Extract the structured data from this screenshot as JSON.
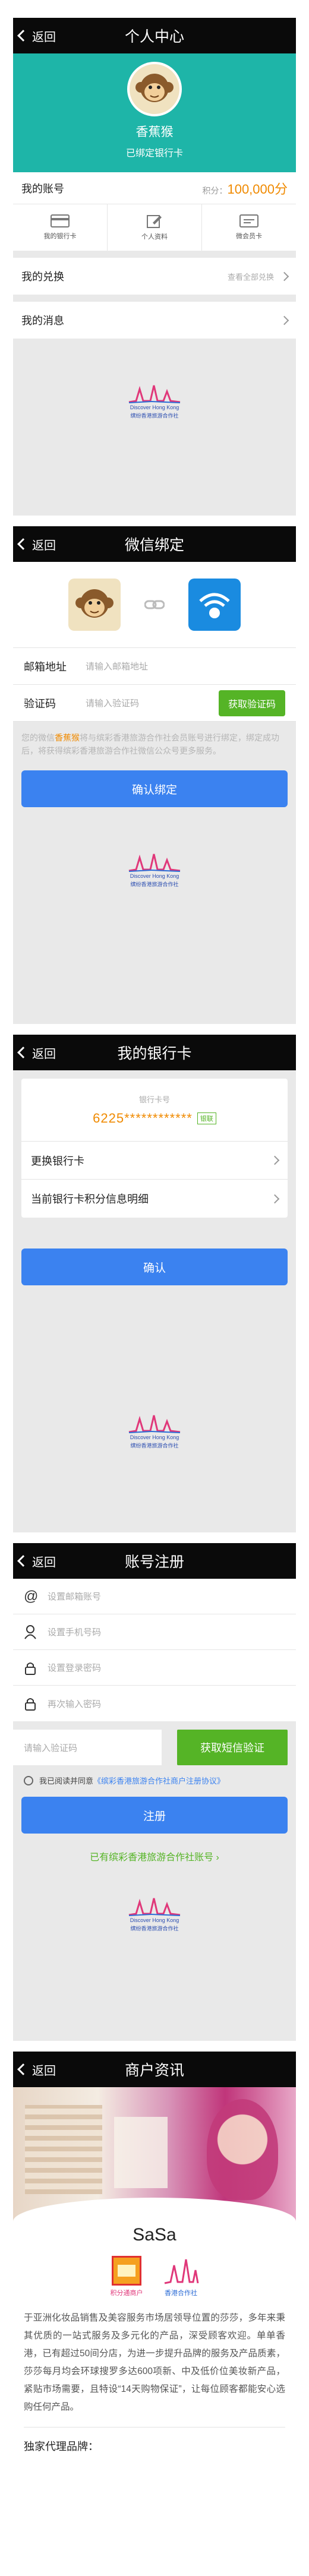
{
  "common": {
    "back_label": "返回",
    "logo_caption": "缤纷香港旅游合作社",
    "logo_script": "Discover Hong Kong"
  },
  "profile": {
    "title": "个人中心",
    "username": "香蕉猴",
    "bind_status": "已绑定银行卡",
    "account_label": "我的账号",
    "points_label": "积分：",
    "points_value": "100,000分",
    "actions": [
      {
        "label": "我的银行卡",
        "icon": "bank-card-icon"
      },
      {
        "label": "个人资料",
        "icon": "edit-profile-icon"
      },
      {
        "label": "微会员卡",
        "icon": "member-card-icon"
      }
    ],
    "redeem_label": "我的兑换",
    "redeem_link": "查看全部兑换",
    "messages_label": "我的消息",
    "accent": "#1eb5a8",
    "points_color": "#f08a00"
  },
  "wechat": {
    "title": "微信绑定",
    "email_label": "邮箱地址",
    "email_placeholder": "请输入邮箱地址",
    "code_label": "验证码",
    "code_placeholder": "请输入验证码",
    "get_code_label": "获取验证码",
    "desc_pre": "您的微信",
    "desc_name": "香蕉猴",
    "desc_post": "将与缤彩香港旅游合作社会员账号进行绑定，绑定成功后，将获得缤彩香港旅游合作社微信公众号更多服务。",
    "confirm_label": "确认绑定"
  },
  "bank": {
    "title": "我的银行卡",
    "card_no_label": "银行卡号",
    "card_no": "6225************",
    "card_badge": "银联",
    "change_label": "更换银行卡",
    "points_detail_label": "当前银行卡积分信息明细",
    "confirm_label": "确认"
  },
  "register": {
    "title": "账号注册",
    "fields": [
      {
        "placeholder": "设置邮箱账号",
        "icon": "at-icon"
      },
      {
        "placeholder": "设置手机号码",
        "icon": "user-icon"
      },
      {
        "placeholder": "设置登录密码",
        "icon": "lock-icon"
      },
      {
        "placeholder": "再次输入密码",
        "icon": "lock-icon"
      }
    ],
    "sms_placeholder": "请输入验证码",
    "sms_button": "获取短信验证",
    "agree_pre": "我已阅读并同意",
    "agree_link": "《缤彩香港旅游合作社商户注册协议》",
    "submit_label": "注册",
    "has_account": "已有缤彩香港旅游合作社账号 ›"
  },
  "merchant": {
    "title": "商户资讯",
    "name": "SaSa",
    "tag1": "积分通商户",
    "tag2": "香港合作社",
    "description": "于亚洲化妆品销售及美容服务市场居领导位置的莎莎，多年来秉其优质的一站式服务及多元化的产品，深受顾客欢迎。单单香港，已有超过50间分店，为进一步提升品牌的服务及产品质素，莎莎每月均会环球搜罗多达600项新、中及低价位美妆新产品，紧贴市场需要，且特设“14天购物保证”，让每位顾客都能安心选购任何产品。",
    "brands_label": "独家代理品牌："
  }
}
